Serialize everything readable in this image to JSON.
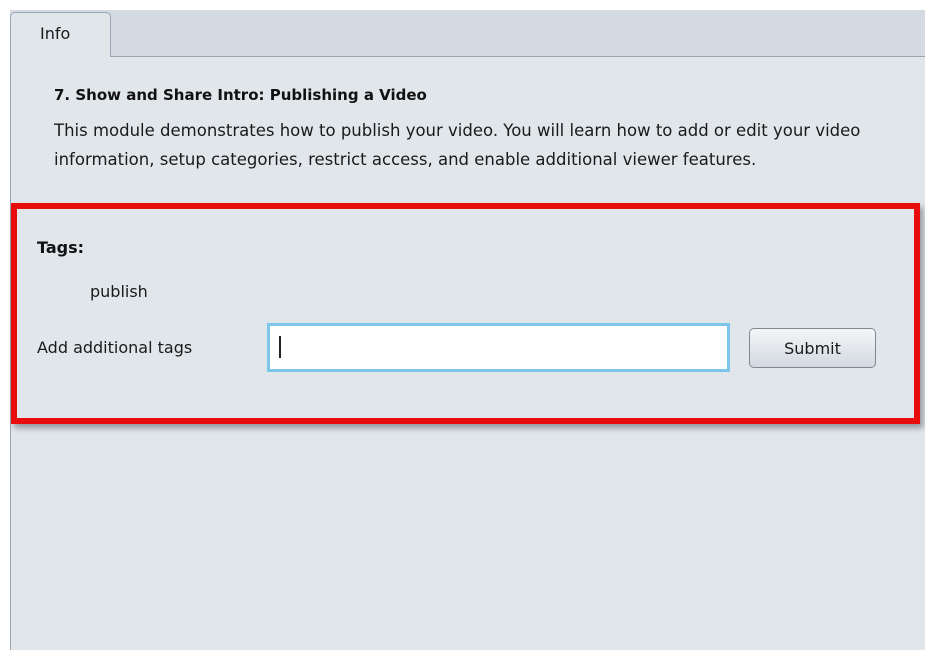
{
  "tabs": [
    {
      "label": "Info",
      "active": true
    }
  ],
  "module": {
    "title": "7. Show and Share Intro: Publishing a Video",
    "description": "This module demonstrates how to publish your video. You will learn how to add or edit your video information, setup categories, restrict access, and enable additional viewer features."
  },
  "tags_section": {
    "heading": "Tags:",
    "tags": [
      "publish"
    ],
    "add_label": "Add additional tags",
    "input_value": "",
    "input_placeholder": "",
    "submit_label": "Submit"
  },
  "colors": {
    "highlight_border": "#e80c0c",
    "panel_background": "#e1e6eb",
    "input_focus_border": "#7cc6ea"
  }
}
